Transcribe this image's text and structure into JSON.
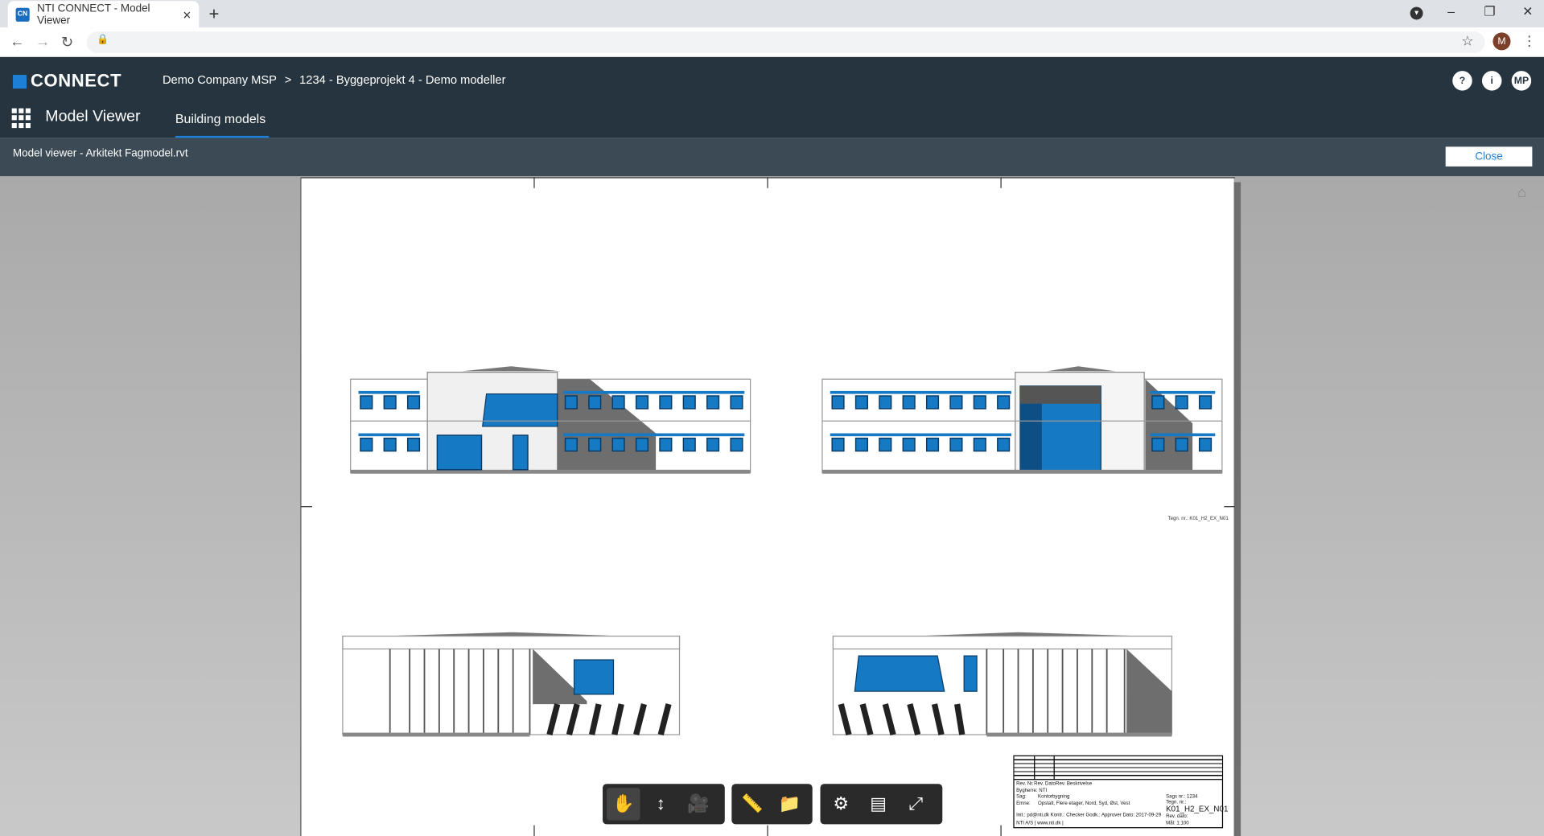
{
  "browser": {
    "tab_title": "NTI CONNECT - Model Viewer",
    "favicon_text": "CN",
    "new_tab": "+",
    "tab_close": "×",
    "profile_initial": "M",
    "window_controls": {
      "minimize": "–",
      "restore": "❐",
      "close": "✕"
    }
  },
  "header": {
    "logo_text": "CONNECT",
    "breadcrumb": [
      "Demo Company MSP",
      ">",
      "1234 - Byggeprojekt 4 - Demo modeller"
    ],
    "help": "?",
    "info": "i",
    "user_initials": "MP",
    "app_title": "Model Viewer",
    "active_tab": "Building models"
  },
  "subbar": {
    "title": "Model viewer - Arkitekt Fagmodel.rvt",
    "close_label": "Close"
  },
  "sheet": {
    "drawing_number_label": "Tegn. nr.: K01_H2_EX_N01",
    "titleblock": {
      "header_cols": [
        "Rev. Nr.",
        "Rev. Dato",
        "Rev. Beskrivelse"
      ],
      "byghere": "Bygherre: NTI",
      "sag_label": "Sag:",
      "sag": "Kontorbygning",
      "emne_label": "Emne:",
      "emne": "Opstalt, Flere etager, Nord, Syd, Øst, Vest",
      "sagsnr": "Sags nr.: 1234",
      "tegn_label": "Tegn. nr.:",
      "drawing_number": "K01_H2_EX_N01",
      "initials": "Init.: pd@nti.dk Kontr.: Checker Godk.: Approver Dato: 2017-09-29",
      "rev_dato": "Rev. dato:",
      "company": "NTI A/S | www.nti.dk |",
      "scale": "Mål: 1:100"
    }
  },
  "toolbar": {
    "groups": [
      [
        "pan-icon",
        "walk-icon",
        "camera-icon"
      ],
      [
        "measure-icon",
        "folder-icon"
      ],
      [
        "settings-icon",
        "properties-icon",
        "fullscreen-icon"
      ]
    ]
  },
  "colors": {
    "header_bg": "#25343e",
    "subbar_bg": "#3b4a54",
    "accent": "#1e7fd6",
    "window_blue": "#1679c3",
    "shadow_gray": "#6e6e6e"
  }
}
